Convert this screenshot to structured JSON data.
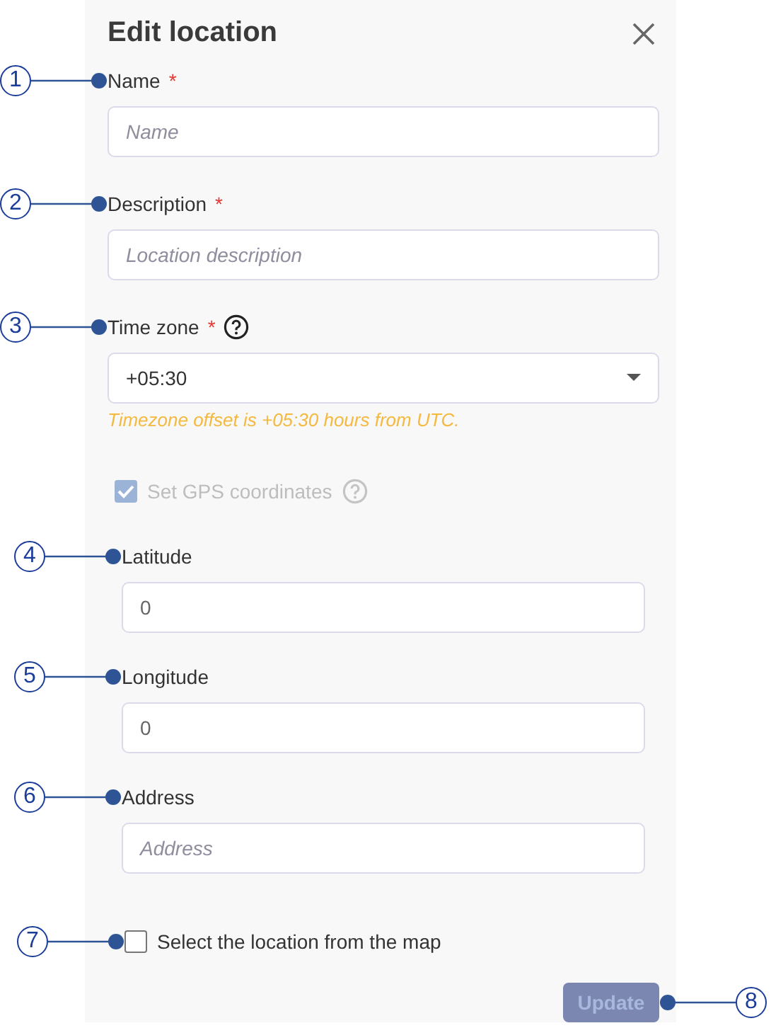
{
  "title": "Edit location",
  "fields": [
    {
      "callout": "1",
      "label": "Name",
      "required_mark": "*",
      "kind": "text",
      "placeholder": "Name"
    },
    {
      "callout": "2",
      "label": "Description",
      "required_mark": "*",
      "kind": "text",
      "placeholder": "Location description"
    },
    {
      "callout": "3",
      "label": "Time zone",
      "required_mark": "*",
      "help": true,
      "kind": "select",
      "value": "+05:30",
      "hint": "Timezone offset is +05:30 hours from UTC."
    }
  ],
  "gps": {
    "label": "Set GPS coordinates",
    "checked": true,
    "disabled": true,
    "help": true,
    "fields": [
      {
        "callout": "4",
        "label": "Latitude",
        "kind": "text",
        "value": "0"
      },
      {
        "callout": "5",
        "label": "Longitude",
        "kind": "text",
        "value": "0"
      },
      {
        "callout": "6",
        "label": "Address",
        "kind": "text",
        "placeholder": "Address"
      }
    ]
  },
  "map_option": {
    "callout": "7",
    "label": "Select the location from the map",
    "checked": false
  },
  "submit": {
    "callout": "8",
    "label": "Update",
    "disabled": true
  }
}
